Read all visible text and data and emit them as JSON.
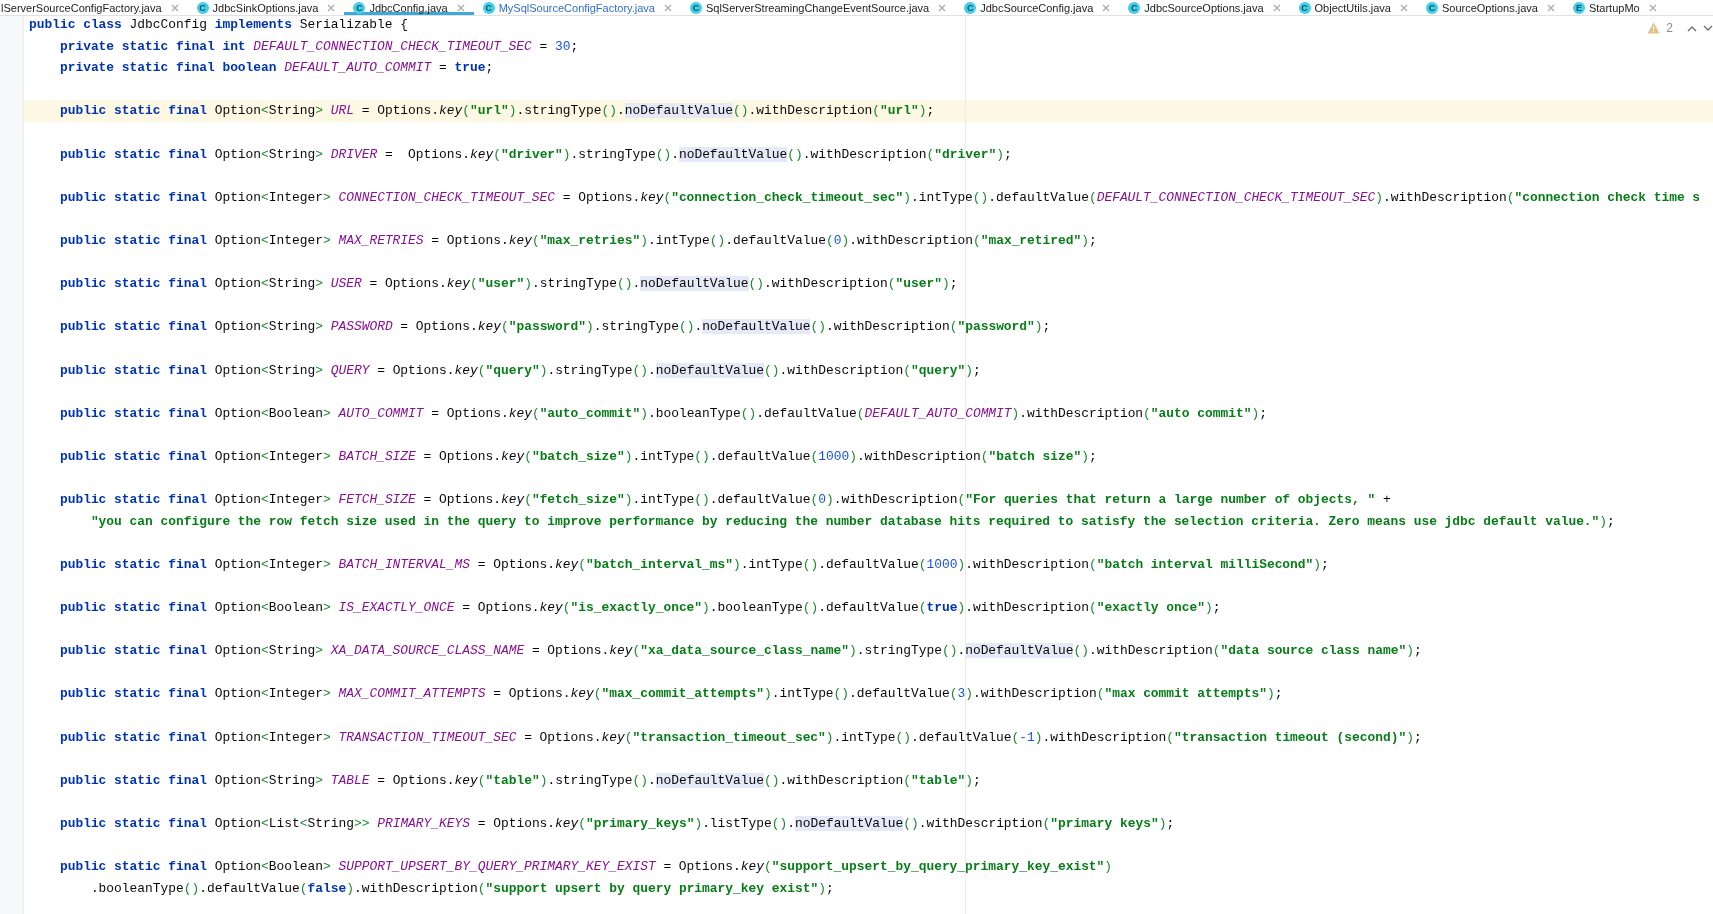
{
  "tabs": [
    {
      "label": "lServerSourceConfigFactory.java",
      "selected": false
    },
    {
      "icon_letter": "C",
      "label": "JdbcSinkOptions.java",
      "selected": false
    },
    {
      "icon_letter": "C",
      "label": "JdbcConfig.java",
      "selected": true
    },
    {
      "icon_letter": "C",
      "label": "MySqlSourceConfigFactory.java",
      "selected": false
    },
    {
      "icon_letter": "C",
      "label": "SqlServerStreamingChangeEventSource.java",
      "selected": false
    },
    {
      "icon_letter": "C",
      "label": "JdbcSourceConfig.java",
      "selected": false
    },
    {
      "icon_letter": "C",
      "label": "JdbcSourceOptions.java",
      "selected": false
    },
    {
      "icon_letter": "C",
      "label": "ObjectUtils.java",
      "selected": false
    },
    {
      "icon_letter": "C",
      "label": "SourceOptions.java",
      "selected": false
    },
    {
      "icon_letter": "E",
      "label": "StartupMo",
      "selected": false
    }
  ],
  "inspections": {
    "warnings": "2"
  },
  "lines": [
    {
      "kind": "code",
      "current": false,
      "tokens": [
        {
          "kind": "kw",
          "text": "public class"
        },
        {
          "kind": "plain",
          "text": " JdbcConfig "
        },
        {
          "kind": "kw",
          "text": "implements"
        },
        {
          "kind": "plain",
          "text": " Serializable {"
        }
      ]
    },
    {
      "kind": "code",
      "current": false,
      "tokens": [
        {
          "kind": "kw",
          "text": "    private static final int "
        },
        {
          "kind": "const",
          "text": "DEFAULT_CONNECTION_CHECK_TIMEOUT_SEC"
        },
        {
          "kind": "plain",
          "text": " = "
        },
        {
          "kind": "number",
          "text": "30"
        },
        {
          "kind": "plain",
          "text": ";"
        }
      ]
    },
    {
      "kind": "code",
      "current": false,
      "tokens": [
        {
          "kind": "kw",
          "text": "    private static final boolean "
        },
        {
          "kind": "const",
          "text": "DEFAULT_AUTO_COMMIT"
        },
        {
          "kind": "plain",
          "text": " = "
        },
        {
          "kind": "kw",
          "text": "true"
        },
        {
          "kind": "plain",
          "text": ";"
        }
      ]
    },
    {
      "kind": "blank"
    },
    {
      "kind": "code",
      "current": true,
      "tokens": [
        {
          "kind": "kw",
          "text": "    public static final"
        },
        {
          "kind": "plain",
          "text": " Option"
        },
        {
          "kind": "bracket",
          "text": "<"
        },
        {
          "kind": "plain",
          "text": "String"
        },
        {
          "kind": "bracket",
          "text": "> "
        },
        {
          "kind": "const",
          "text": "URL"
        },
        {
          "kind": "plain",
          "text": " = Options."
        },
        {
          "kind": "method",
          "text": "key"
        },
        {
          "kind": "bracket",
          "text": "("
        },
        {
          "kind": "string",
          "text": "\"url\""
        },
        {
          "kind": "bracket",
          "text": ")"
        },
        {
          "kind": "plain",
          "text": ".stringType"
        },
        {
          "kind": "bracket",
          "text": "()"
        },
        {
          "kind": "plain",
          "text": "."
        },
        {
          "kind": "match",
          "text": "noDefaultValue"
        },
        {
          "kind": "bracket",
          "text": "()"
        },
        {
          "kind": "plain",
          "text": ".withDescription"
        },
        {
          "kind": "bracket",
          "text": "("
        },
        {
          "kind": "string",
          "text": "\"url\""
        },
        {
          "kind": "bracket",
          "text": ")"
        },
        {
          "kind": "plain",
          "text": ";"
        }
      ]
    },
    {
      "kind": "blank"
    },
    {
      "kind": "code",
      "current": false,
      "tokens": [
        {
          "kind": "kw",
          "text": "    public static final"
        },
        {
          "kind": "plain",
          "text": " Option"
        },
        {
          "kind": "bracket",
          "text": "<"
        },
        {
          "kind": "plain",
          "text": "String"
        },
        {
          "kind": "bracket",
          "text": "> "
        },
        {
          "kind": "const",
          "text": "DRIVER"
        },
        {
          "kind": "plain",
          "text": " =  Options."
        },
        {
          "kind": "method",
          "text": "key"
        },
        {
          "kind": "bracket",
          "text": "("
        },
        {
          "kind": "string",
          "text": "\"driver\""
        },
        {
          "kind": "bracket",
          "text": ")"
        },
        {
          "kind": "plain",
          "text": ".stringType"
        },
        {
          "kind": "bracket",
          "text": "()"
        },
        {
          "kind": "plain",
          "text": "."
        },
        {
          "kind": "match",
          "text": "noDefaultValue"
        },
        {
          "kind": "bracket",
          "text": "()"
        },
        {
          "kind": "plain",
          "text": ".withDescription"
        },
        {
          "kind": "bracket",
          "text": "("
        },
        {
          "kind": "string",
          "text": "\"driver\""
        },
        {
          "kind": "bracket",
          "text": ")"
        },
        {
          "kind": "plain",
          "text": ";"
        }
      ]
    },
    {
      "kind": "blank"
    },
    {
      "kind": "code",
      "current": false,
      "tokens": [
        {
          "kind": "kw",
          "text": "    public static final"
        },
        {
          "kind": "plain",
          "text": " Option"
        },
        {
          "kind": "bracket",
          "text": "<"
        },
        {
          "kind": "plain",
          "text": "Integer"
        },
        {
          "kind": "bracket",
          "text": "> "
        },
        {
          "kind": "const",
          "text": "CONNECTION_CHECK_TIMEOUT_SEC"
        },
        {
          "kind": "plain",
          "text": " = Options."
        },
        {
          "kind": "method",
          "text": "key"
        },
        {
          "kind": "bracket",
          "text": "("
        },
        {
          "kind": "string",
          "text": "\"connection_check_timeout_sec\""
        },
        {
          "kind": "bracket",
          "text": ")"
        },
        {
          "kind": "plain",
          "text": ".intType"
        },
        {
          "kind": "bracket",
          "text": "()"
        },
        {
          "kind": "plain",
          "text": ".defaultValue"
        },
        {
          "kind": "bracket",
          "text": "("
        },
        {
          "kind": "const",
          "text": "DEFAULT_CONNECTION_CHECK_TIMEOUT_SEC"
        },
        {
          "kind": "bracket",
          "text": ")"
        },
        {
          "kind": "plain",
          "text": ".withDescription"
        },
        {
          "kind": "bracket",
          "text": "("
        },
        {
          "kind": "string",
          "text": "\"connection check time s"
        }
      ]
    },
    {
      "kind": "blank"
    },
    {
      "kind": "code",
      "current": false,
      "tokens": [
        {
          "kind": "kw",
          "text": "    public static final"
        },
        {
          "kind": "plain",
          "text": " Option"
        },
        {
          "kind": "bracket",
          "text": "<"
        },
        {
          "kind": "plain",
          "text": "Integer"
        },
        {
          "kind": "bracket",
          "text": "> "
        },
        {
          "kind": "const",
          "text": "MAX_RETRIES"
        },
        {
          "kind": "plain",
          "text": " = Options."
        },
        {
          "kind": "method",
          "text": "key"
        },
        {
          "kind": "bracket",
          "text": "("
        },
        {
          "kind": "string",
          "text": "\"max_retries\""
        },
        {
          "kind": "bracket",
          "text": ")"
        },
        {
          "kind": "plain",
          "text": ".intType"
        },
        {
          "kind": "bracket",
          "text": "()"
        },
        {
          "kind": "plain",
          "text": ".defaultValue"
        },
        {
          "kind": "bracket",
          "text": "("
        },
        {
          "kind": "number",
          "text": "0"
        },
        {
          "kind": "bracket",
          "text": ")"
        },
        {
          "kind": "plain",
          "text": ".withDescription"
        },
        {
          "kind": "bracket",
          "text": "("
        },
        {
          "kind": "string",
          "text": "\"max_retired\""
        },
        {
          "kind": "bracket",
          "text": ")"
        },
        {
          "kind": "plain",
          "text": ";"
        }
      ]
    },
    {
      "kind": "blank"
    },
    {
      "kind": "code",
      "current": false,
      "tokens": [
        {
          "kind": "kw",
          "text": "    public static final"
        },
        {
          "kind": "plain",
          "text": " Option"
        },
        {
          "kind": "bracket",
          "text": "<"
        },
        {
          "kind": "plain",
          "text": "String"
        },
        {
          "kind": "bracket",
          "text": "> "
        },
        {
          "kind": "const",
          "text": "USER"
        },
        {
          "kind": "plain",
          "text": " = Options."
        },
        {
          "kind": "method",
          "text": "key"
        },
        {
          "kind": "bracket",
          "text": "("
        },
        {
          "kind": "string",
          "text": "\"user\""
        },
        {
          "kind": "bracket",
          "text": ")"
        },
        {
          "kind": "plain",
          "text": ".stringType"
        },
        {
          "kind": "bracket",
          "text": "()"
        },
        {
          "kind": "plain",
          "text": "."
        },
        {
          "kind": "match",
          "text": "noDefaultValue"
        },
        {
          "kind": "bracket",
          "text": "()"
        },
        {
          "kind": "plain",
          "text": ".withDescription"
        },
        {
          "kind": "bracket",
          "text": "("
        },
        {
          "kind": "string",
          "text": "\"user\""
        },
        {
          "kind": "bracket",
          "text": ")"
        },
        {
          "kind": "plain",
          "text": ";"
        }
      ]
    },
    {
      "kind": "blank"
    },
    {
      "kind": "code",
      "current": false,
      "tokens": [
        {
          "kind": "kw",
          "text": "    public static final"
        },
        {
          "kind": "plain",
          "text": " Option"
        },
        {
          "kind": "bracket",
          "text": "<"
        },
        {
          "kind": "plain",
          "text": "String"
        },
        {
          "kind": "bracket",
          "text": "> "
        },
        {
          "kind": "const",
          "text": "PASSWORD"
        },
        {
          "kind": "plain",
          "text": " = Options."
        },
        {
          "kind": "method",
          "text": "key"
        },
        {
          "kind": "bracket",
          "text": "("
        },
        {
          "kind": "string",
          "text": "\"password\""
        },
        {
          "kind": "bracket",
          "text": ")"
        },
        {
          "kind": "plain",
          "text": ".stringType"
        },
        {
          "kind": "bracket",
          "text": "()"
        },
        {
          "kind": "plain",
          "text": "."
        },
        {
          "kind": "match",
          "text": "noDefaultValue"
        },
        {
          "kind": "bracket",
          "text": "()"
        },
        {
          "kind": "plain",
          "text": ".withDescription"
        },
        {
          "kind": "bracket",
          "text": "("
        },
        {
          "kind": "string",
          "text": "\"password\""
        },
        {
          "kind": "bracket",
          "text": ")"
        },
        {
          "kind": "plain",
          "text": ";"
        }
      ]
    },
    {
      "kind": "blank"
    },
    {
      "kind": "code",
      "current": false,
      "tokens": [
        {
          "kind": "kw",
          "text": "    public static final"
        },
        {
          "kind": "plain",
          "text": " Option"
        },
        {
          "kind": "bracket",
          "text": "<"
        },
        {
          "kind": "plain",
          "text": "String"
        },
        {
          "kind": "bracket",
          "text": "> "
        },
        {
          "kind": "const",
          "text": "QUERY"
        },
        {
          "kind": "plain",
          "text": " = Options."
        },
        {
          "kind": "method",
          "text": "key"
        },
        {
          "kind": "bracket",
          "text": "("
        },
        {
          "kind": "string",
          "text": "\"query\""
        },
        {
          "kind": "bracket",
          "text": ")"
        },
        {
          "kind": "plain",
          "text": ".stringType"
        },
        {
          "kind": "bracket",
          "text": "()"
        },
        {
          "kind": "plain",
          "text": "."
        },
        {
          "kind": "match",
          "text": "noDefaultValue"
        },
        {
          "kind": "bracket",
          "text": "()"
        },
        {
          "kind": "plain",
          "text": ".withDescription"
        },
        {
          "kind": "bracket",
          "text": "("
        },
        {
          "kind": "string",
          "text": "\"query\""
        },
        {
          "kind": "bracket",
          "text": ")"
        },
        {
          "kind": "plain",
          "text": ";"
        }
      ]
    },
    {
      "kind": "blank"
    },
    {
      "kind": "code",
      "current": false,
      "tokens": [
        {
          "kind": "kw",
          "text": "    public static final"
        },
        {
          "kind": "plain",
          "text": " Option"
        },
        {
          "kind": "bracket",
          "text": "<"
        },
        {
          "kind": "plain",
          "text": "Boolean"
        },
        {
          "kind": "bracket",
          "text": "> "
        },
        {
          "kind": "const",
          "text": "AUTO_COMMIT"
        },
        {
          "kind": "plain",
          "text": " = Options."
        },
        {
          "kind": "method",
          "text": "key"
        },
        {
          "kind": "bracket",
          "text": "("
        },
        {
          "kind": "string",
          "text": "\"auto_commit\""
        },
        {
          "kind": "bracket",
          "text": ")"
        },
        {
          "kind": "plain",
          "text": ".booleanType"
        },
        {
          "kind": "bracket",
          "text": "()"
        },
        {
          "kind": "plain",
          "text": ".defaultValue"
        },
        {
          "kind": "bracket",
          "text": "("
        },
        {
          "kind": "const",
          "text": "DEFAULT_AUTO_COMMIT"
        },
        {
          "kind": "bracket",
          "text": ")"
        },
        {
          "kind": "plain",
          "text": ".withDescription"
        },
        {
          "kind": "bracket",
          "text": "("
        },
        {
          "kind": "string",
          "text": "\"auto commit\""
        },
        {
          "kind": "bracket",
          "text": ")"
        },
        {
          "kind": "plain",
          "text": ";"
        }
      ]
    },
    {
      "kind": "blank"
    },
    {
      "kind": "code",
      "current": false,
      "tokens": [
        {
          "kind": "kw",
          "text": "    public static final"
        },
        {
          "kind": "plain",
          "text": " Option"
        },
        {
          "kind": "bracket",
          "text": "<"
        },
        {
          "kind": "plain",
          "text": "Integer"
        },
        {
          "kind": "bracket",
          "text": "> "
        },
        {
          "kind": "const",
          "text": "BATCH_SIZE"
        },
        {
          "kind": "plain",
          "text": " = Options."
        },
        {
          "kind": "method",
          "text": "key"
        },
        {
          "kind": "bracket",
          "text": "("
        },
        {
          "kind": "string",
          "text": "\"batch_size\""
        },
        {
          "kind": "bracket",
          "text": ")"
        },
        {
          "kind": "plain",
          "text": ".intType"
        },
        {
          "kind": "bracket",
          "text": "()"
        },
        {
          "kind": "plain",
          "text": ".defaultValue"
        },
        {
          "kind": "bracket",
          "text": "("
        },
        {
          "kind": "number",
          "text": "1000"
        },
        {
          "kind": "bracket",
          "text": ")"
        },
        {
          "kind": "plain",
          "text": ".withDescription"
        },
        {
          "kind": "bracket",
          "text": "("
        },
        {
          "kind": "string",
          "text": "\"batch size\""
        },
        {
          "kind": "bracket",
          "text": ")"
        },
        {
          "kind": "plain",
          "text": ";"
        }
      ]
    },
    {
      "kind": "blank"
    },
    {
      "kind": "code",
      "current": false,
      "tokens": [
        {
          "kind": "kw",
          "text": "    public static final"
        },
        {
          "kind": "plain",
          "text": " Option"
        },
        {
          "kind": "bracket",
          "text": "<"
        },
        {
          "kind": "plain",
          "text": "Integer"
        },
        {
          "kind": "bracket",
          "text": "> "
        },
        {
          "kind": "const",
          "text": "FETCH_SIZE"
        },
        {
          "kind": "plain",
          "text": " = Options."
        },
        {
          "kind": "method",
          "text": "key"
        },
        {
          "kind": "bracket",
          "text": "("
        },
        {
          "kind": "string",
          "text": "\"fetch_size\""
        },
        {
          "kind": "bracket",
          "text": ")"
        },
        {
          "kind": "plain",
          "text": ".intType"
        },
        {
          "kind": "bracket",
          "text": "()"
        },
        {
          "kind": "plain",
          "text": ".defaultValue"
        },
        {
          "kind": "bracket",
          "text": "("
        },
        {
          "kind": "number",
          "text": "0"
        },
        {
          "kind": "bracket",
          "text": ")"
        },
        {
          "kind": "plain",
          "text": ".withDescription"
        },
        {
          "kind": "bracket",
          "text": "("
        },
        {
          "kind": "string",
          "text": "\"For queries that return a large number of objects, \""
        },
        {
          "kind": "plain",
          "text": " +"
        }
      ]
    },
    {
      "kind": "code",
      "current": false,
      "tokens": [
        {
          "kind": "string",
          "text": "        \"you can configure the row fetch size used in the query to improve performance by reducing the number database hits required to satisfy the selection criteria. Zero means use jdbc default value.\""
        },
        {
          "kind": "bracket",
          "text": ")"
        },
        {
          "kind": "plain",
          "text": ";"
        }
      ]
    },
    {
      "kind": "blank"
    },
    {
      "kind": "code",
      "current": false,
      "tokens": [
        {
          "kind": "kw",
          "text": "    public static final"
        },
        {
          "kind": "plain",
          "text": " Option"
        },
        {
          "kind": "bracket",
          "text": "<"
        },
        {
          "kind": "plain",
          "text": "Integer"
        },
        {
          "kind": "bracket",
          "text": "> "
        },
        {
          "kind": "const",
          "text": "BATCH_INTERVAL_MS"
        },
        {
          "kind": "plain",
          "text": " = Options."
        },
        {
          "kind": "method",
          "text": "key"
        },
        {
          "kind": "bracket",
          "text": "("
        },
        {
          "kind": "string",
          "text": "\"batch_interval_ms\""
        },
        {
          "kind": "bracket",
          "text": ")"
        },
        {
          "kind": "plain",
          "text": ".intType"
        },
        {
          "kind": "bracket",
          "text": "()"
        },
        {
          "kind": "plain",
          "text": ".defaultValue"
        },
        {
          "kind": "bracket",
          "text": "("
        },
        {
          "kind": "number",
          "text": "1000"
        },
        {
          "kind": "bracket",
          "text": ")"
        },
        {
          "kind": "plain",
          "text": ".withDescription"
        },
        {
          "kind": "bracket",
          "text": "("
        },
        {
          "kind": "string",
          "text": "\"batch interval milliSecond\""
        },
        {
          "kind": "bracket",
          "text": ")"
        },
        {
          "kind": "plain",
          "text": ";"
        }
      ]
    },
    {
      "kind": "blank"
    },
    {
      "kind": "code",
      "current": false,
      "tokens": [
        {
          "kind": "kw",
          "text": "    public static final"
        },
        {
          "kind": "plain",
          "text": " Option"
        },
        {
          "kind": "bracket",
          "text": "<"
        },
        {
          "kind": "plain",
          "text": "Boolean"
        },
        {
          "kind": "bracket",
          "text": "> "
        },
        {
          "kind": "const",
          "text": "IS_EXACTLY_ONCE"
        },
        {
          "kind": "plain",
          "text": " = Options."
        },
        {
          "kind": "method",
          "text": "key"
        },
        {
          "kind": "bracket",
          "text": "("
        },
        {
          "kind": "string",
          "text": "\"is_exactly_once\""
        },
        {
          "kind": "bracket",
          "text": ")"
        },
        {
          "kind": "plain",
          "text": ".booleanType"
        },
        {
          "kind": "bracket",
          "text": "()"
        },
        {
          "kind": "plain",
          "text": ".defaultValue"
        },
        {
          "kind": "bracket",
          "text": "("
        },
        {
          "kind": "kw",
          "text": "true"
        },
        {
          "kind": "bracket",
          "text": ")"
        },
        {
          "kind": "plain",
          "text": ".withDescription"
        },
        {
          "kind": "bracket",
          "text": "("
        },
        {
          "kind": "string",
          "text": "\"exactly once\""
        },
        {
          "kind": "bracket",
          "text": ")"
        },
        {
          "kind": "plain",
          "text": ";"
        }
      ]
    },
    {
      "kind": "blank"
    },
    {
      "kind": "code",
      "current": false,
      "tokens": [
        {
          "kind": "kw",
          "text": "    public static final"
        },
        {
          "kind": "plain",
          "text": " Option"
        },
        {
          "kind": "bracket",
          "text": "<"
        },
        {
          "kind": "plain",
          "text": "String"
        },
        {
          "kind": "bracket",
          "text": "> "
        },
        {
          "kind": "const",
          "text": "XA_DATA_SOURCE_CLASS_NAME"
        },
        {
          "kind": "plain",
          "text": " = Options."
        },
        {
          "kind": "method",
          "text": "key"
        },
        {
          "kind": "bracket",
          "text": "("
        },
        {
          "kind": "string",
          "text": "\"xa_data_source_class_name\""
        },
        {
          "kind": "bracket",
          "text": ")"
        },
        {
          "kind": "plain",
          "text": ".stringType"
        },
        {
          "kind": "bracket",
          "text": "()"
        },
        {
          "kind": "plain",
          "text": "."
        },
        {
          "kind": "match",
          "text": "noDefaultValue"
        },
        {
          "kind": "bracket",
          "text": "()"
        },
        {
          "kind": "plain",
          "text": ".withDescription"
        },
        {
          "kind": "bracket",
          "text": "("
        },
        {
          "kind": "string",
          "text": "\"data source class name\""
        },
        {
          "kind": "bracket",
          "text": ")"
        },
        {
          "kind": "plain",
          "text": ";"
        }
      ]
    },
    {
      "kind": "blank"
    },
    {
      "kind": "code",
      "current": false,
      "tokens": [
        {
          "kind": "kw",
          "text": "    public static final"
        },
        {
          "kind": "plain",
          "text": " Option"
        },
        {
          "kind": "bracket",
          "text": "<"
        },
        {
          "kind": "plain",
          "text": "Integer"
        },
        {
          "kind": "bracket",
          "text": "> "
        },
        {
          "kind": "const",
          "text": "MAX_COMMIT_ATTEMPTS"
        },
        {
          "kind": "plain",
          "text": " = Options."
        },
        {
          "kind": "method",
          "text": "key"
        },
        {
          "kind": "bracket",
          "text": "("
        },
        {
          "kind": "string",
          "text": "\"max_commit_attempts\""
        },
        {
          "kind": "bracket",
          "text": ")"
        },
        {
          "kind": "plain",
          "text": ".intType"
        },
        {
          "kind": "bracket",
          "text": "()"
        },
        {
          "kind": "plain",
          "text": ".defaultValue"
        },
        {
          "kind": "bracket",
          "text": "("
        },
        {
          "kind": "number",
          "text": "3"
        },
        {
          "kind": "bracket",
          "text": ")"
        },
        {
          "kind": "plain",
          "text": ".withDescription"
        },
        {
          "kind": "bracket",
          "text": "("
        },
        {
          "kind": "string",
          "text": "\"max commit attempts\""
        },
        {
          "kind": "bracket",
          "text": ")"
        },
        {
          "kind": "plain",
          "text": ";"
        }
      ]
    },
    {
      "kind": "blank"
    },
    {
      "kind": "code",
      "current": false,
      "tokens": [
        {
          "kind": "kw",
          "text": "    public static final"
        },
        {
          "kind": "plain",
          "text": " Option"
        },
        {
          "kind": "bracket",
          "text": "<"
        },
        {
          "kind": "plain",
          "text": "Integer"
        },
        {
          "kind": "bracket",
          "text": "> "
        },
        {
          "kind": "const",
          "text": "TRANSACTION_TIMEOUT_SEC"
        },
        {
          "kind": "plain",
          "text": " = Options."
        },
        {
          "kind": "method",
          "text": "key"
        },
        {
          "kind": "bracket",
          "text": "("
        },
        {
          "kind": "string",
          "text": "\"transaction_timeout_sec\""
        },
        {
          "kind": "bracket",
          "text": ")"
        },
        {
          "kind": "plain",
          "text": ".intType"
        },
        {
          "kind": "bracket",
          "text": "()"
        },
        {
          "kind": "plain",
          "text": ".defaultValue"
        },
        {
          "kind": "bracket",
          "text": "("
        },
        {
          "kind": "number",
          "text": "-1"
        },
        {
          "kind": "bracket",
          "text": ")"
        },
        {
          "kind": "plain",
          "text": ".withDescription"
        },
        {
          "kind": "bracket",
          "text": "("
        },
        {
          "kind": "string",
          "text": "\"transaction timeout (second)\""
        },
        {
          "kind": "bracket",
          "text": ")"
        },
        {
          "kind": "plain",
          "text": ";"
        }
      ]
    },
    {
      "kind": "blank"
    },
    {
      "kind": "code",
      "current": false,
      "tokens": [
        {
          "kind": "kw",
          "text": "    public static final"
        },
        {
          "kind": "plain",
          "text": " Option"
        },
        {
          "kind": "bracket",
          "text": "<"
        },
        {
          "kind": "plain",
          "text": "String"
        },
        {
          "kind": "bracket",
          "text": "> "
        },
        {
          "kind": "const",
          "text": "TABLE"
        },
        {
          "kind": "plain",
          "text": " = Options."
        },
        {
          "kind": "method",
          "text": "key"
        },
        {
          "kind": "bracket",
          "text": "("
        },
        {
          "kind": "string",
          "text": "\"table\""
        },
        {
          "kind": "bracket",
          "text": ")"
        },
        {
          "kind": "plain",
          "text": ".stringType"
        },
        {
          "kind": "bracket",
          "text": "()"
        },
        {
          "kind": "plain",
          "text": "."
        },
        {
          "kind": "match",
          "text": "noDefaultValue"
        },
        {
          "kind": "bracket",
          "text": "()"
        },
        {
          "kind": "plain",
          "text": ".withDescription"
        },
        {
          "kind": "bracket",
          "text": "("
        },
        {
          "kind": "string",
          "text": "\"table\""
        },
        {
          "kind": "bracket",
          "text": ")"
        },
        {
          "kind": "plain",
          "text": ";"
        }
      ]
    },
    {
      "kind": "blank"
    },
    {
      "kind": "code",
      "current": false,
      "tokens": [
        {
          "kind": "kw",
          "text": "    public static final"
        },
        {
          "kind": "plain",
          "text": " Option"
        },
        {
          "kind": "bracket",
          "text": "<"
        },
        {
          "kind": "plain",
          "text": "List"
        },
        {
          "kind": "bracket",
          "text": "<"
        },
        {
          "kind": "plain",
          "text": "String"
        },
        {
          "kind": "bracket",
          "text": ">> "
        },
        {
          "kind": "const",
          "text": "PRIMARY_KEYS"
        },
        {
          "kind": "plain",
          "text": " = Options."
        },
        {
          "kind": "method",
          "text": "key"
        },
        {
          "kind": "bracket",
          "text": "("
        },
        {
          "kind": "string",
          "text": "\"primary_keys\""
        },
        {
          "kind": "bracket",
          "text": ")"
        },
        {
          "kind": "plain",
          "text": ".listType"
        },
        {
          "kind": "bracket",
          "text": "()"
        },
        {
          "kind": "plain",
          "text": "."
        },
        {
          "kind": "match",
          "text": "noDefaultValue"
        },
        {
          "kind": "bracket",
          "text": "()"
        },
        {
          "kind": "plain",
          "text": ".withDescription"
        },
        {
          "kind": "bracket",
          "text": "("
        },
        {
          "kind": "string",
          "text": "\"primary keys\""
        },
        {
          "kind": "bracket",
          "text": ")"
        },
        {
          "kind": "plain",
          "text": ";"
        }
      ]
    },
    {
      "kind": "blank"
    },
    {
      "kind": "code",
      "current": false,
      "tokens": [
        {
          "kind": "kw",
          "text": "    public static final"
        },
        {
          "kind": "plain",
          "text": " Option"
        },
        {
          "kind": "bracket",
          "text": "<"
        },
        {
          "kind": "plain",
          "text": "Boolean"
        },
        {
          "kind": "bracket",
          "text": "> "
        },
        {
          "kind": "const",
          "text": "SUPPORT_UPSERT_BY_QUERY_PRIMARY_KEY_EXIST"
        },
        {
          "kind": "plain",
          "text": " = Options."
        },
        {
          "kind": "method",
          "text": "key"
        },
        {
          "kind": "bracket",
          "text": "("
        },
        {
          "kind": "string",
          "text": "\"support_upsert_by_query_primary_key_exist\""
        },
        {
          "kind": "bracket",
          "text": ")"
        }
      ]
    },
    {
      "kind": "code",
      "current": false,
      "tokens": [
        {
          "kind": "plain",
          "text": "        .booleanType"
        },
        {
          "kind": "bracket",
          "text": "()"
        },
        {
          "kind": "plain",
          "text": ".defaultValue"
        },
        {
          "kind": "bracket",
          "text": "("
        },
        {
          "kind": "kw",
          "text": "false"
        },
        {
          "kind": "bracket",
          "text": ")"
        },
        {
          "kind": "plain",
          "text": ".withDescription"
        },
        {
          "kind": "bracket",
          "text": "("
        },
        {
          "kind": "string",
          "text": "\"support upsert by query primary_key exist\""
        },
        {
          "kind": "bracket",
          "text": ")"
        },
        {
          "kind": "plain",
          "text": ";"
        }
      ]
    }
  ]
}
